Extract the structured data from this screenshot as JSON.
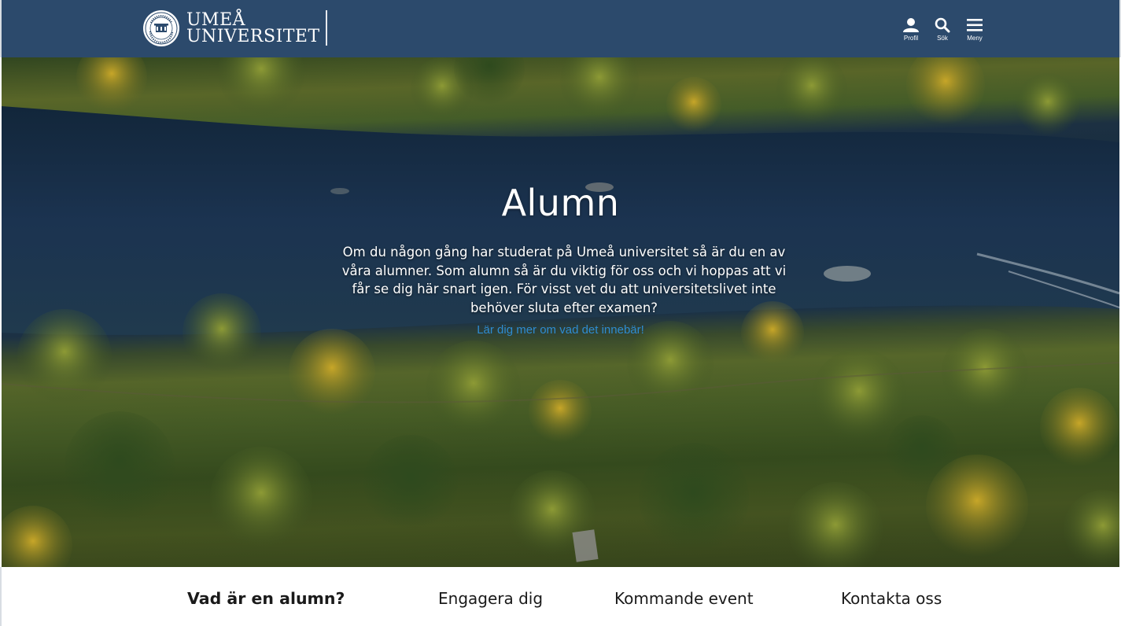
{
  "header": {
    "logo": {
      "line1": "UMEÅ",
      "line2": "UNIVERSITET",
      "seal_icon": "university-seal-icon"
    },
    "actions": [
      {
        "label": "Profil",
        "icon": "user-icon"
      },
      {
        "label": "Sök",
        "icon": "search-icon"
      },
      {
        "label": "Meny",
        "icon": "hamburger-menu-icon"
      }
    ]
  },
  "hero": {
    "title": "Alumn",
    "text": "Om du någon gång har studerat på Umeå universitet så är du en av våra alumner. Som alumn så är du viktig för oss och vi hoppas att vi får se dig här snart igen. För visst vet du att universitetslivet inte behöver sluta efter examen?",
    "link": "Lär dig mer om vad det innebär!"
  },
  "subnav": {
    "items": [
      {
        "label": "Vad är en alumn?",
        "active": true
      },
      {
        "label": "Engagera dig",
        "active": false
      },
      {
        "label": "Kommande event",
        "active": false
      },
      {
        "label": "Kontakta oss",
        "active": false
      }
    ]
  },
  "colors": {
    "header_bg": "#2c4a6c",
    "link": "#2e8bd1",
    "text_dark": "#1a1a1a"
  }
}
